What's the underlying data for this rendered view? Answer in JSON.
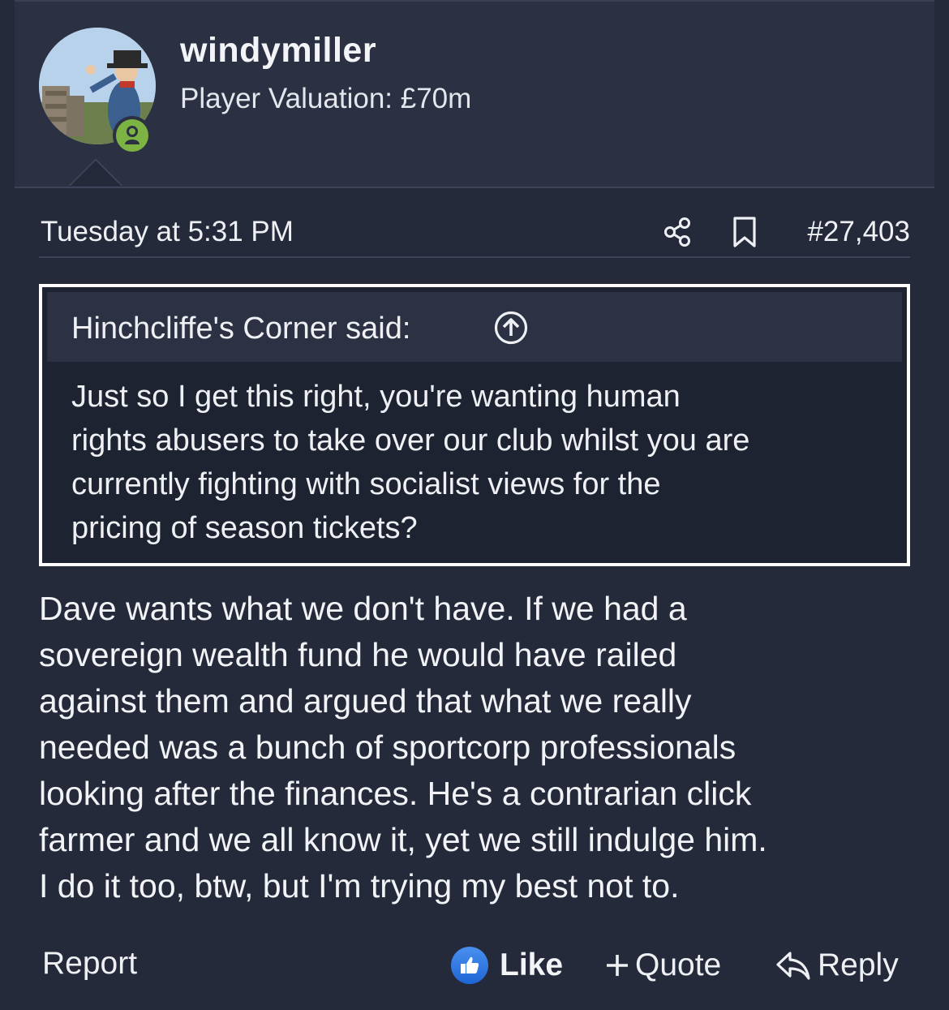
{
  "author": {
    "username": "windymiller",
    "valuation": "Player Valuation: £70m",
    "status": "online",
    "status_color": "#7cb342"
  },
  "post": {
    "timestamp": "Tuesday at 5:31 PM",
    "number": "#27,403",
    "body_lines": [
      "Dave wants what we don't have. If we had a",
      "sovereign wealth fund he would have railed",
      "against them and argued that what we really",
      "needed was a bunch of sportcorp professionals",
      "looking after the finances. He's a contrarian click",
      "farmer and we all know it, yet we still indulge him.",
      "I do it too, btw, but I'm trying my best not to."
    ]
  },
  "quote": {
    "author_line": "Hinchcliffe's Corner said:",
    "body_lines": [
      "Just so I get this right, you're wanting human",
      "rights abusers to take over our club whilst you are",
      "currently fighting with socialist views for the",
      "pricing of season tickets?"
    ]
  },
  "actions": {
    "report": "Report",
    "like": "Like",
    "quote": "Quote",
    "reply": "Reply"
  },
  "icons": {
    "share": "share-icon",
    "bookmark": "bookmark-icon",
    "quote_jump": "arrow-up-circle-icon",
    "like": "thumbs-up-icon",
    "quote": "plus-icon",
    "reply": "reply-arrow-icon",
    "status": "user-icon"
  },
  "colors": {
    "background": "#252a3a",
    "header_background": "#2b3042",
    "quote_background": "#1e2332",
    "like_blue": "#1f66d6"
  }
}
